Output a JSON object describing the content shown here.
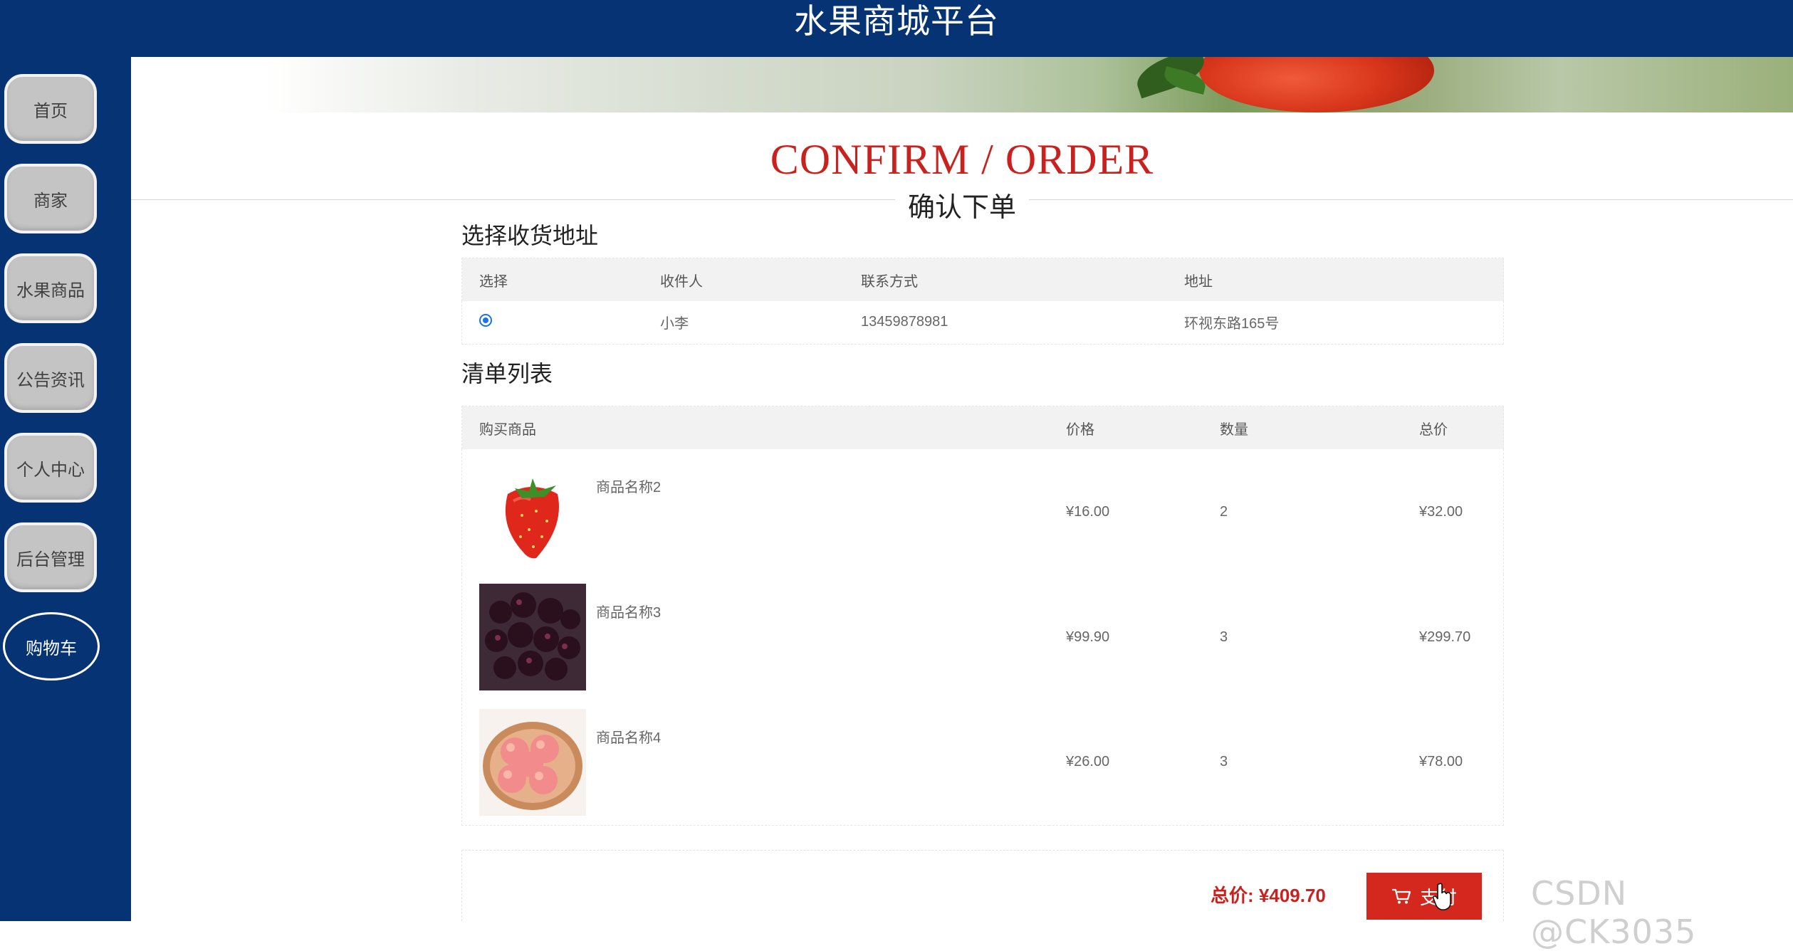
{
  "header": {
    "title": "水果商城平台"
  },
  "sidebar": {
    "items": [
      {
        "label": "首页"
      },
      {
        "label": "商家"
      },
      {
        "label": "水果商品"
      },
      {
        "label": "公告资讯"
      },
      {
        "label": "个人中心"
      },
      {
        "label": "后台管理"
      },
      {
        "label": "购物车",
        "active": true
      }
    ]
  },
  "section": {
    "title_en": "CONFIRM / ORDER",
    "title_cn": "确认下单"
  },
  "address": {
    "heading": "选择收货地址",
    "columns": [
      "选择",
      "收件人",
      "联系方式",
      "地址"
    ],
    "rows": [
      {
        "selected": true,
        "name": "小李",
        "phone": "13459878981",
        "address": "环视东路165号"
      }
    ]
  },
  "orderlist": {
    "heading": "清单列表",
    "columns": [
      "购买商品",
      "价格",
      "数量",
      "总价"
    ],
    "items": [
      {
        "name": "商品名称2",
        "price": "¥16.00",
        "qty": "2",
        "total": "¥32.00",
        "image": "strawberry"
      },
      {
        "name": "商品名称3",
        "price": "¥99.90",
        "qty": "3",
        "total": "¥299.70",
        "image": "mulberry"
      },
      {
        "name": "商品名称4",
        "price": "¥26.00",
        "qty": "3",
        "total": "¥78.00",
        "image": "peach"
      }
    ]
  },
  "summary": {
    "total_label": "总价:",
    "total_value": "¥409.70",
    "pay_label": "支付",
    "pay_icon": "cart-icon"
  },
  "watermark": "CSDN @CK3035",
  "colors": {
    "header_bg": "#063373",
    "accent_red": "#c9221e",
    "pay_button": "#d4281f"
  }
}
